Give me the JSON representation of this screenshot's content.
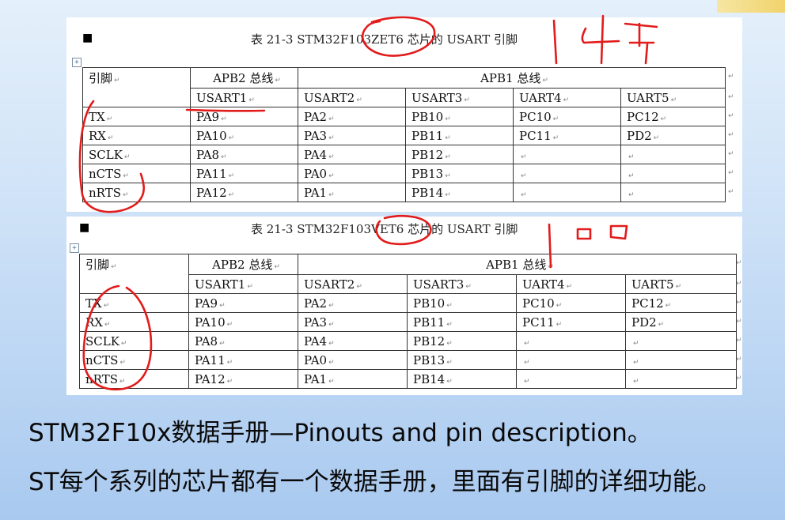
{
  "table1": {
    "caption": "表 21-3 STM32F103ZET6 芯片的 USART 引脚",
    "header_pin": "引脚",
    "header_apb2": "APB2 总线",
    "header_apb1": "APB1 总线",
    "columns": [
      "USART1",
      "USART2",
      "USART3",
      "UART4",
      "UART5"
    ],
    "rows": [
      {
        "pin": "TX",
        "vals": [
          "PA9",
          "PA2",
          "PB10",
          "PC10",
          "PC12"
        ]
      },
      {
        "pin": "RX",
        "vals": [
          "PA10",
          "PA3",
          "PB11",
          "PC11",
          "PD2"
        ]
      },
      {
        "pin": "SCLK",
        "vals": [
          "PA8",
          "PA4",
          "PB12",
          "",
          ""
        ]
      },
      {
        "pin": "nCTS",
        "vals": [
          "PA11",
          "PA0",
          "PB13",
          "",
          ""
        ]
      },
      {
        "pin": "nRTS",
        "vals": [
          "PA12",
          "PA1",
          "PB14",
          "",
          ""
        ]
      }
    ]
  },
  "table2": {
    "caption": "表 21-3 STM32F103VET6 芯片的 USART 引脚",
    "header_pin": "引脚",
    "header_apb2": "APB2 总线",
    "header_apb1": "APB1 总线",
    "columns": [
      "USART1",
      "USART2",
      "USART3",
      "UART4",
      "UART5"
    ],
    "rows": [
      {
        "pin": "TX",
        "vals": [
          "PA9",
          "PA2",
          "PB10",
          "PC10",
          "PC12"
        ]
      },
      {
        "pin": "RX",
        "vals": [
          "PA10",
          "PA3",
          "PB11",
          "PC11",
          "PD2"
        ]
      },
      {
        "pin": "SCLK",
        "vals": [
          "PA8",
          "PA4",
          "PB12",
          "",
          ""
        ]
      },
      {
        "pin": "nCTS",
        "vals": [
          "PA11",
          "PA0",
          "PB13",
          "",
          ""
        ]
      },
      {
        "pin": "nRTS",
        "vals": [
          "PA12",
          "PA1",
          "PB14",
          "",
          ""
        ]
      }
    ]
  },
  "annotation_colors": {
    "ink": "#e21b1b"
  },
  "text_lines": [
    "STM32F10x数据手册—Pinouts and pin description。",
    "ST每个系列的芯片都有一个数据手册，里面有引脚的详细功能。"
  ]
}
